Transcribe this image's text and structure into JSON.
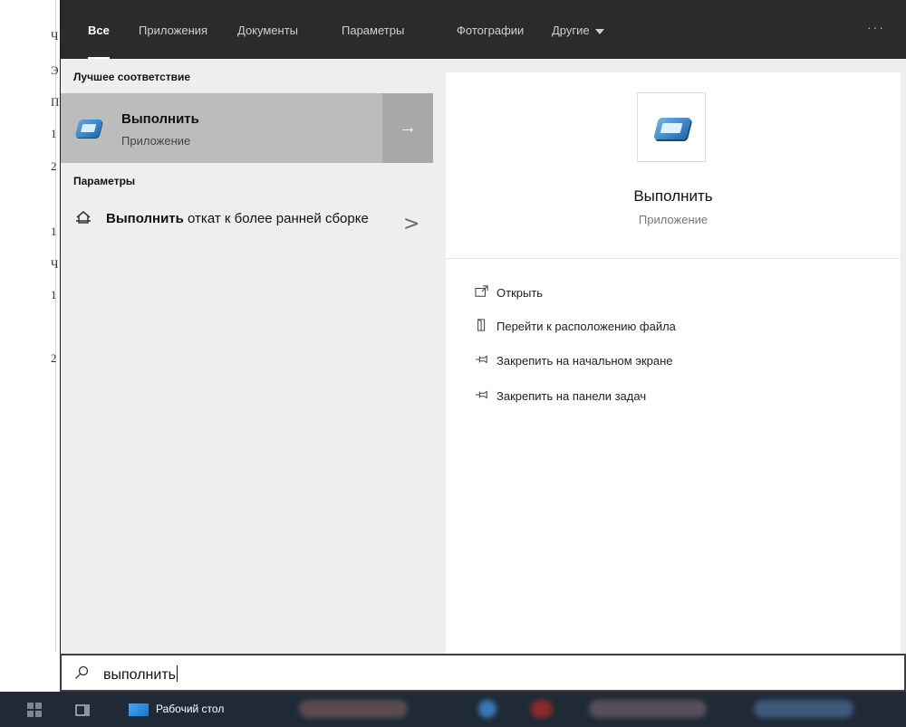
{
  "background_doc": {
    "letters": [
      "Ч",
      "Э",
      "П",
      "1",
      "2",
      "1",
      "Ч",
      "1",
      "2"
    ]
  },
  "tabs": {
    "items": [
      {
        "label": "Все",
        "active": true
      },
      {
        "label": "Приложения",
        "active": false
      },
      {
        "label": "Документы",
        "active": false
      },
      {
        "label": "Параметры",
        "active": false
      },
      {
        "label": "Фотографии",
        "active": false
      },
      {
        "label": "Другие",
        "active": false,
        "dropdown": true
      }
    ],
    "more_label": "···"
  },
  "results": {
    "best_match_title": "Лучшее соответствие",
    "best_match": {
      "title": "Выполнить",
      "subtitle": "Приложение",
      "icon": "run-app-icon",
      "arrow": "→"
    },
    "settings_title": "Параметры",
    "settings_item": {
      "bold": "Выполнить",
      "rest": " откат к более ранней сборке",
      "icon": "rollback-icon",
      "chevron": ">"
    }
  },
  "preview": {
    "title": "Выполнить",
    "subtitle": "Приложение",
    "icon": "run-app-icon",
    "actions": [
      {
        "label": "Открыть",
        "icon": "open-icon"
      },
      {
        "label": "Перейти к расположению файла",
        "icon": "file-location-icon"
      },
      {
        "label": "Закрепить на начальном экране",
        "icon": "pin-icon"
      },
      {
        "label": "Закрепить на панели задач",
        "icon": "pin-icon"
      }
    ]
  },
  "search": {
    "value": "выполнить",
    "icon": "search-icon"
  },
  "taskbar": {
    "desktop_label": "Рабочий стол",
    "colors": {
      "background": "#1f2a36",
      "accent": "#1576cf"
    }
  }
}
